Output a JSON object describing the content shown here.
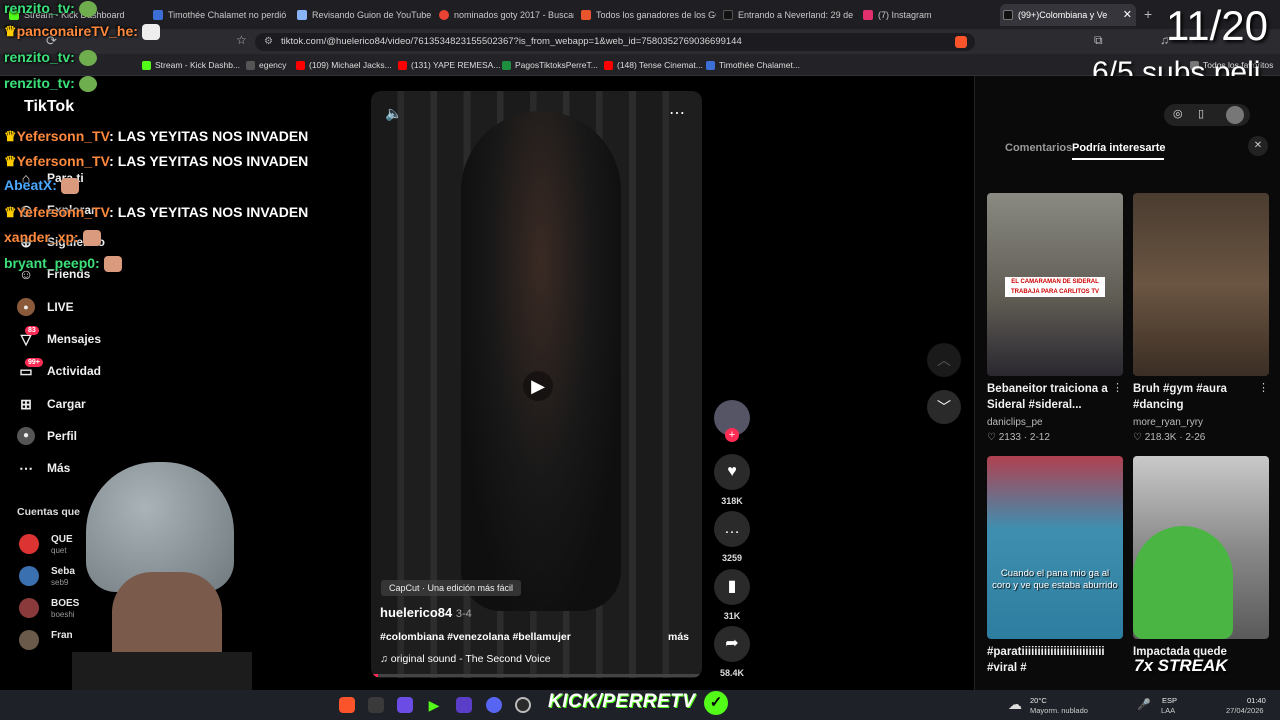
{
  "browser": {
    "tabs": [
      {
        "label": "Stream - Kick Dashboard",
        "color": "#53fc18"
      },
      {
        "label": "Timothée Chalamet no perdió",
        "color": "#3b6fd6"
      },
      {
        "label": "Revisando Guion de YouTube",
        "color": "#8ab4f8"
      },
      {
        "label": "nominados goty 2017 - Buscar",
        "color": "#ea4335"
      },
      {
        "label": "Todos los ganadores de los GO",
        "color": "#e8542b"
      },
      {
        "label": "Entrando a Neverland: 29 de a",
        "color": "#111111"
      },
      {
        "label": "(7) Instagram",
        "color": "#e1306c"
      },
      {
        "label": "(99+)Colombiana y Ve",
        "color": "#111111"
      }
    ],
    "url": "tiktok.com/@huelerico84/video/7613534823155502367?is_from_webapp=1&web_id=7580352769036699144",
    "bookmarks": [
      {
        "label": "Stream - Kick Dashb...",
        "color": "#53fc18"
      },
      {
        "label": "egency",
        "color": "#555555"
      },
      {
        "label": "(109) Michael Jacks...",
        "color": "#ff0000"
      },
      {
        "label": "(131) YAPE REMESA...",
        "color": "#ff0000"
      },
      {
        "label": "PagosTiktoksPerreT...",
        "color": "#1e8e3e"
      },
      {
        "label": "(148) Tense Cinemat...",
        "color": "#ff0000"
      },
      {
        "label": "Timothée Chalamet...",
        "color": "#3b6fd6"
      }
    ],
    "favorites_label": "Todos los favoritos"
  },
  "overlay": {
    "counter": "11/20",
    "subs_text": "6/5 subs peli",
    "streak": "7x STREAK",
    "kick_brand": "KICK/PERRETV"
  },
  "chat": [
    {
      "user": "renzito_tv:",
      "msg": "",
      "color": "green"
    },
    {
      "user": "panconaireTV_he:",
      "msg": "",
      "color": "orange"
    },
    {
      "user": "renzito_tv:",
      "msg": "",
      "color": "green"
    },
    {
      "user": "renzito_tv:",
      "msg": "",
      "color": "green"
    },
    {
      "user": "Yefersonn_TV",
      "msg": ": LAS YEYITAS NOS INVADEN",
      "color": "orange"
    },
    {
      "user": "Yefersonn_TV",
      "msg": ": LAS YEYITAS NOS INVADEN",
      "color": "orange"
    },
    {
      "user": "AbeatX:",
      "msg": "",
      "color": "blue"
    },
    {
      "user": "Yefersonn_TV",
      "msg": ": LAS YEYITAS NOS INVADEN",
      "color": "orange"
    },
    {
      "user": "xander_xp:",
      "msg": "",
      "color": "orange"
    },
    {
      "user": "bryant_peep0:",
      "msg": "",
      "color": "green"
    }
  ],
  "sidebar": {
    "logo": "TikTok",
    "items": [
      {
        "label": "Para ti",
        "icon": "home-icon"
      },
      {
        "label": "Explorar",
        "icon": "compass-icon"
      },
      {
        "label": "Siguiendo",
        "icon": "following-icon"
      },
      {
        "label": "Friends",
        "icon": "friends-icon"
      },
      {
        "label": "LIVE",
        "icon": "live-icon"
      },
      {
        "label": "Mensajes",
        "icon": "message-icon",
        "badge": "83"
      },
      {
        "label": "Actividad",
        "icon": "activity-icon",
        "badge": "99+"
      },
      {
        "label": "Cargar",
        "icon": "upload-icon"
      },
      {
        "label": "Perfil",
        "icon": "profile-icon"
      },
      {
        "label": "Más",
        "icon": "more-icon"
      }
    ],
    "following_header": "Cuentas que",
    "accounts": [
      {
        "name": "QUE",
        "sub": "quet"
      },
      {
        "name": "Seba",
        "sub": "seb9"
      },
      {
        "name": "BOES",
        "sub": "boeshi"
      },
      {
        "name": "Fran",
        "sub": ""
      }
    ]
  },
  "video": {
    "author": "huelerico84",
    "date": "3-4",
    "hashtags": "#colombiana #venezolana #bellamujer",
    "more": "más",
    "sound": "original sound - The Second Voice",
    "capcut": "CapCut · Una edición más fácil",
    "progress": 0.02
  },
  "actions": {
    "likes": "318K",
    "comments": "3259",
    "saves": "31K",
    "shares": "58.4K"
  },
  "right_panel": {
    "tabs": [
      "Comentarios",
      "Podría interesarte"
    ],
    "active_tab": "Podría interesarte",
    "cards": [
      {
        "title": "Bebaneitor traiciona a Sideral #sideral...",
        "author": "daniclips_pe",
        "likes": "2133",
        "date": "2-12",
        "thumb_caption": "EL CAMARAMAN DE SIDERAL TRABAJA PARA CARLITOS TV",
        "bg": "#6d6a63"
      },
      {
        "title": "Bruh #gym #aura #dancing",
        "author": "more_ryan_ryry",
        "likes": "218.3K",
        "date": "2-26",
        "thumb_caption": "",
        "bg": "#5b4a3c"
      },
      {
        "title": "#paratiiiiiiiiiiiiiiiiiiiiiiiiii #viral #",
        "author": "",
        "likes": "",
        "date": "",
        "thumb_caption": "Cuando el pana mio ga al coro y ve que estaba aburrido",
        "bg": "#3f8fb0"
      },
      {
        "title": "Impactada quede",
        "author": "",
        "likes": "",
        "date": "",
        "thumb_caption": "",
        "bg": "#a8a8a8"
      }
    ]
  },
  "taskbar": {
    "weather_temp": "20°C",
    "weather_desc": "Mayorm. nublado",
    "lang1": "ESP",
    "lang2": "LAA",
    "time": "01:40",
    "date": "27/04/2026"
  }
}
